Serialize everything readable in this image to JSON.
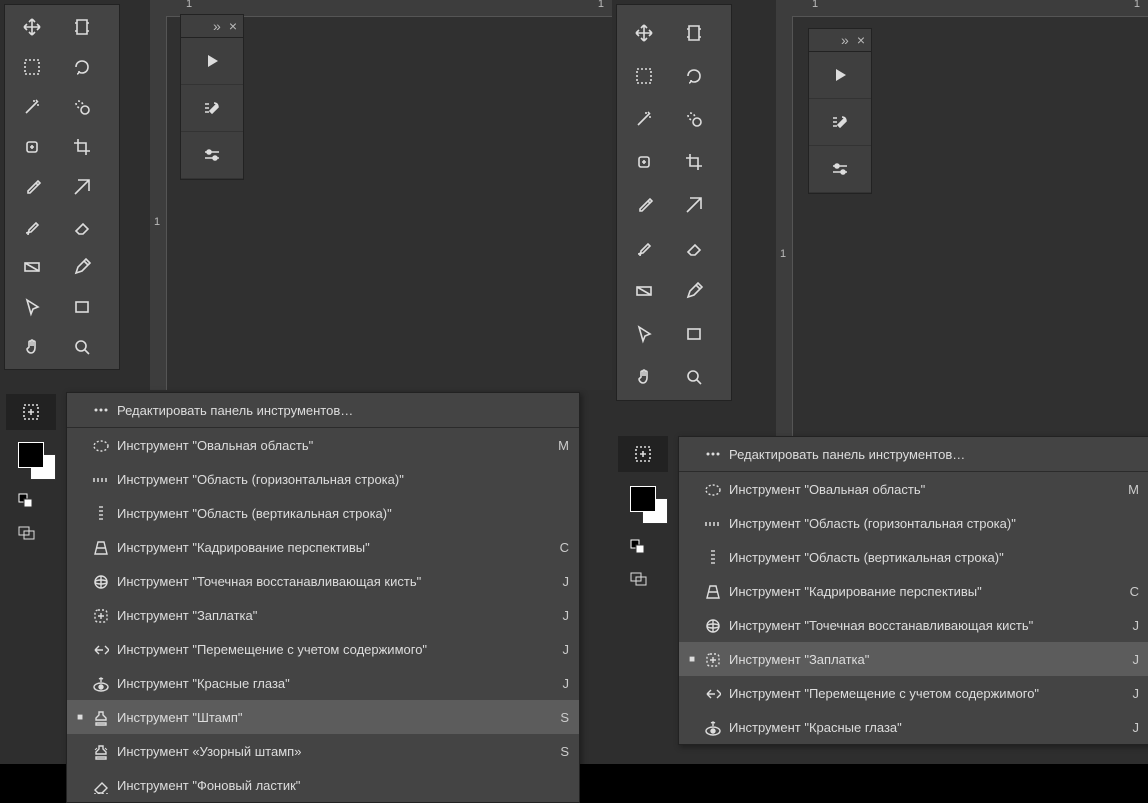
{
  "ruler": {
    "label_top_left": "1",
    "label_top_right": "1",
    "label_side": "1"
  },
  "panel": {
    "expand": "»",
    "close": "×"
  },
  "flyout": {
    "edit": "Редактировать панель инструментов…",
    "items": [
      {
        "icon": "ellipse",
        "label": "Инструмент \"Овальная область\"",
        "key": "M"
      },
      {
        "icon": "rowmarq",
        "label": "Инструмент \"Область (горизонтальная строка)\"",
        "key": ""
      },
      {
        "icon": "colmarq",
        "label": "Инструмент \"Область (вертикальная строка)\"",
        "key": ""
      },
      {
        "icon": "perspcrop",
        "label": "Инструмент \"Кадрирование перспективы\"",
        "key": "C"
      },
      {
        "icon": "spotheal",
        "label": "Инструмент \"Точечная восстанавливающая кисть\"",
        "key": "J"
      },
      {
        "icon": "patch",
        "label": "Инструмент \"Заплатка\"",
        "key": "J"
      },
      {
        "icon": "contentmove",
        "label": "Инструмент \"Перемещение с учетом содержимого\"",
        "key": "J"
      },
      {
        "icon": "redeye",
        "label": "Инструмент \"Красные глаза\"",
        "key": "J"
      },
      {
        "icon": "stamp",
        "label": "Инструмент \"Штамп\"",
        "key": "S"
      },
      {
        "icon": "patternstamp",
        "label": "Инструмент «Узорный штамп»",
        "key": "S"
      },
      {
        "icon": "bgeraser",
        "label": "Инструмент \"Фоновый ластик\"",
        "key": ""
      }
    ]
  },
  "left": {
    "flyout_selected_index": 8
  },
  "right": {
    "flyout_selected_index": 5
  }
}
